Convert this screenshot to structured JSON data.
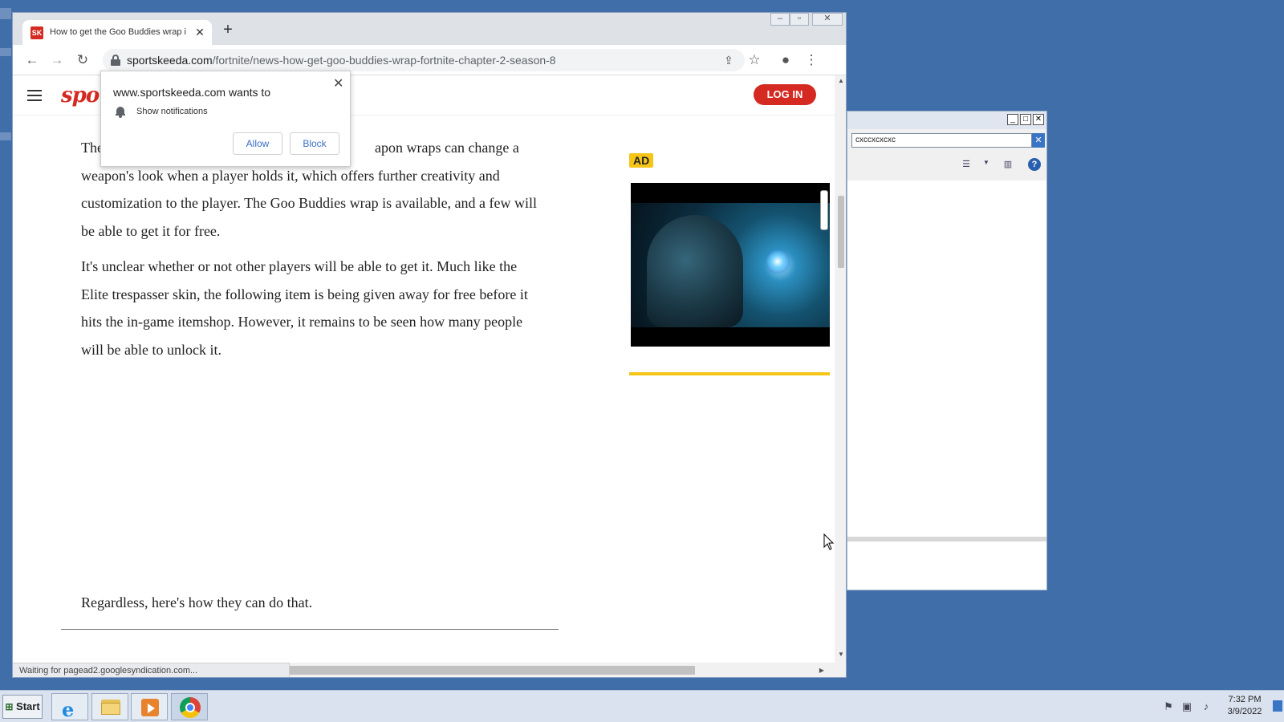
{
  "browser": {
    "tab_title": "How to get the Goo Buddies wrap in Fortnite",
    "tab_favicon": "SK",
    "url_domain": "sportskeeda.com",
    "url_path": "/fortnite/news-how-get-goo-buddies-wrap-fortnite-chapter-2-season-8",
    "status_text": "Waiting for pagead2.googlesyndication.com..."
  },
  "site": {
    "logo_text": "spo",
    "login_label": "LOG IN"
  },
  "article": {
    "p1_start": "The",
    "p1_rest": "apon wraps can change a weapon's look when a player holds it, which offers further creativity and customization to the player. The Goo Buddies wrap is available, and a few will be able to get it for free.",
    "p2": "It's unclear whether or not other players will be able to get it. Much like the Elite trespasser skin, the following item is being given away for free before it hits the in-game itemshop. However, it remains to be seen how many people will be able to unlock it.",
    "p3": "Regardless, here's how they can do that."
  },
  "ad": {
    "badge": "AD"
  },
  "notification": {
    "title": "www.sportskeeda.com wants to",
    "permission": "Show notifications",
    "allow": "Allow",
    "block": "Block"
  },
  "side_window": {
    "search_value": "cxccxcxcxc"
  },
  "taskbar": {
    "start_label": "Start",
    "time": "7:32 PM",
    "date": "3/9/2022"
  },
  "icons": [
    "back-icon",
    "forward-icon",
    "reload-icon",
    "lock-icon",
    "share-icon",
    "star-icon",
    "profile-icon",
    "menu-dots-icon",
    "bell-icon",
    "help-icon"
  ]
}
